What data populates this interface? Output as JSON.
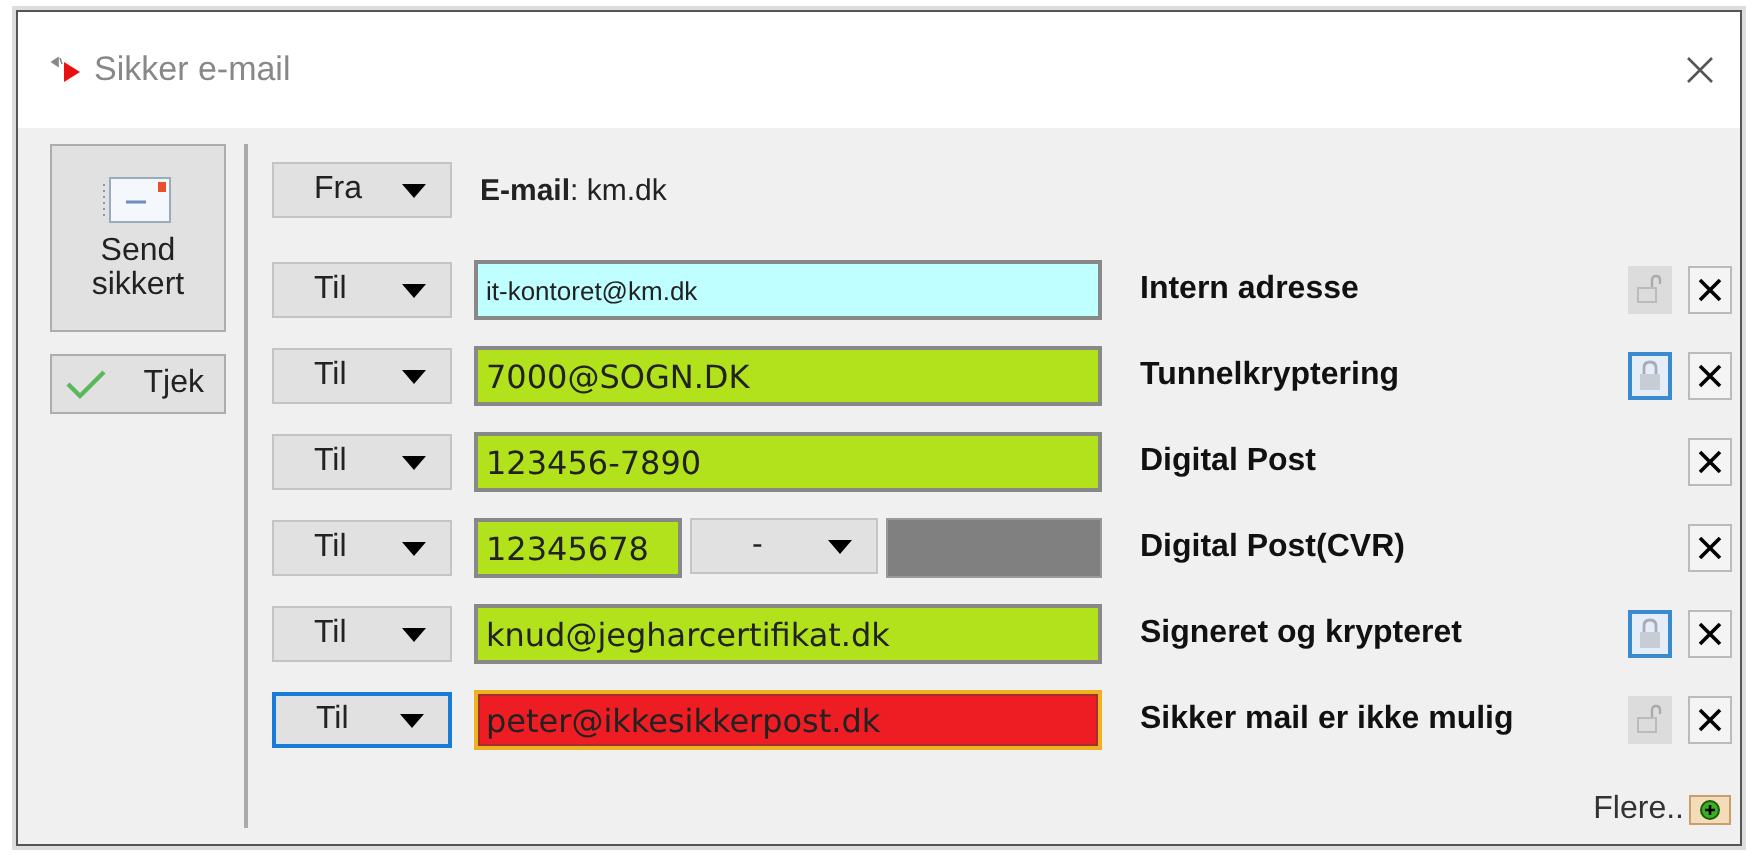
{
  "window": {
    "title": "Sikker e-mail"
  },
  "actions": [
    {
      "kind": "send",
      "label": "Send\nsikkert"
    },
    {
      "kind": "check",
      "label": "Tjek"
    }
  ],
  "sender": {
    "type": "Fra",
    "text": "**E-mail**: km.dk"
  },
  "recipients": [
    {
      "kind": "email",
      "type": "Til",
      "focused": false,
      "value": "it-kontoret@km.dk",
      "color": "#bfffff",
      "error": false,
      "status": "Intern adresse",
      "encrypted": false
    },
    {
      "kind": "email",
      "type": "Til",
      "focused": false,
      "value": "7000@SOGN.DK",
      "color": "#b2e21c",
      "error": false,
      "status": "Tunnelkryptering",
      "encrypted": true
    },
    {
      "kind": "email",
      "type": "Til",
      "focused": false,
      "value": "123456-7890",
      "color": "#b2e21c",
      "error": false,
      "status": "Digital Post"
    },
    {
      "kind": "cvr",
      "type": "Til",
      "focused": false,
      "value": "12345678",
      "color": "#b2e21c",
      "option": "-",
      "status": "Digital Post(CVR)"
    },
    {
      "kind": "email",
      "type": "Til",
      "focused": false,
      "value": "knud@jegharcertifikat.dk",
      "color": "#b2e21c",
      "error": false,
      "status": "Signeret og krypteret",
      "encrypted": true
    },
    {
      "kind": "email",
      "type": "Til",
      "focused": true,
      "value": "peter@ikkesikkerpost.dk",
      "color": "#ee1d24",
      "error": true,
      "status": "Sikker mail er ikke mulig",
      "encrypted": false
    }
  ],
  "more": {
    "label": "Flere.."
  }
}
